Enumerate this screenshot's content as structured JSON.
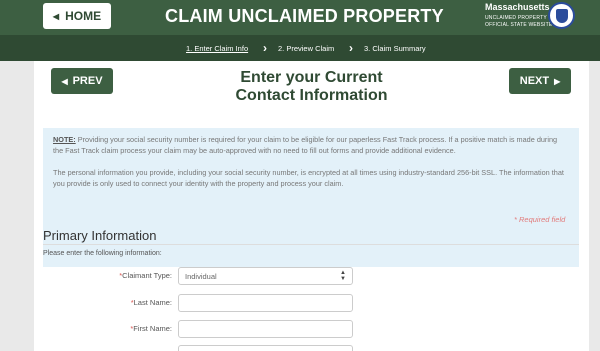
{
  "header": {
    "home_label": "HOME",
    "title": "CLAIM UNCLAIMED PROPERTY",
    "logo": {
      "name": "Massachusetts",
      "line1": "UNCLAIMED PROPERTY",
      "line2": "OFFICIAL STATE WEBSITE"
    }
  },
  "steps": [
    {
      "label": "1. Enter Claim Info",
      "active": true
    },
    {
      "label": "2. Preview Claim",
      "active": false
    },
    {
      "label": "3. Claim Summary",
      "active": false
    }
  ],
  "nav": {
    "prev_label": "PREV",
    "next_label": "NEXT"
  },
  "page_title_line1": "Enter your Current",
  "page_title_line2": "Contact Information",
  "notice": {
    "note_label": "NOTE:",
    "paragraph1": " Providing your social security number is required for your claim to be eligible for our paperless Fast Track process. If a positive match is made during the Fast Track claim process your claim may be auto-approved with no need to fill out forms and provide additional evidence.",
    "paragraph2": "The personal information you provide, including your social security number, is encrypted at all times using industry-standard 256-bit SSL. The information that you provide is only used to connect your identity with the property and process your claim."
  },
  "required_note": "* Required field",
  "section": {
    "title": "Primary Information",
    "instructions": "Please enter the following information:"
  },
  "form": {
    "claimant_type": {
      "label": "Claimant Type:",
      "value": "Individual"
    },
    "last_name": {
      "label": "Last Name:",
      "value": ""
    },
    "first_name": {
      "label": "First Name:",
      "value": ""
    }
  },
  "colors": {
    "brand_green": "#3d5f42",
    "dark_green": "#2f4a33",
    "notice_bg": "#e3f1f9",
    "required_red": "#d9534f"
  }
}
